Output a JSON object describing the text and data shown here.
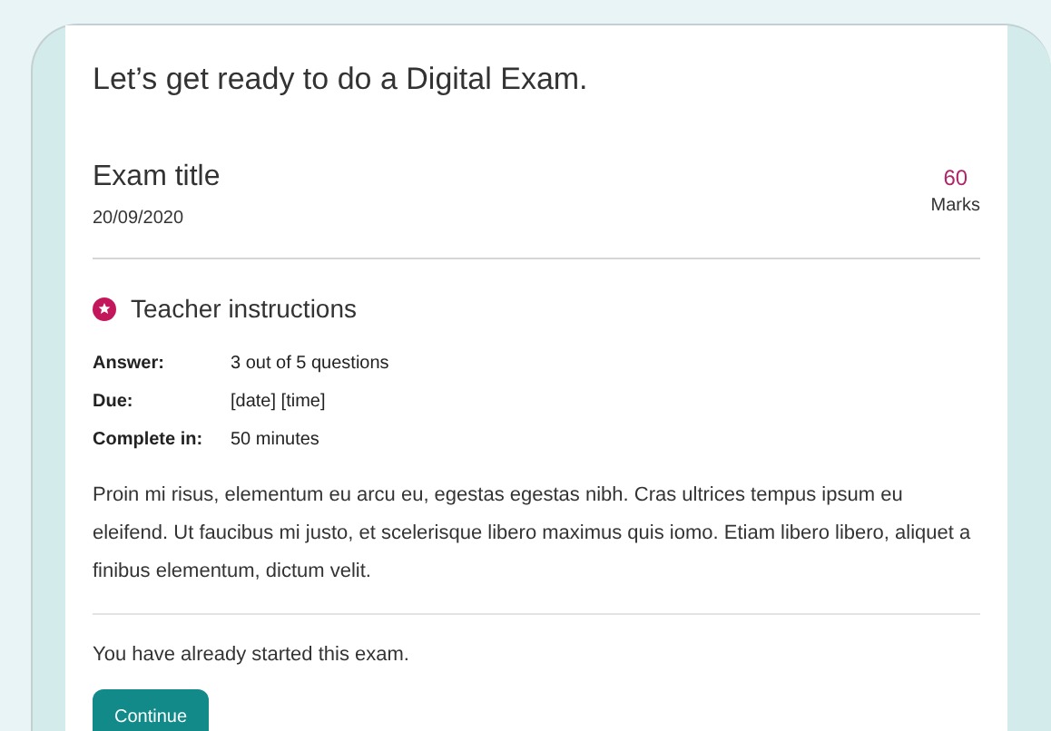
{
  "heading": "Let’s get ready to do a Digital Exam.",
  "exam": {
    "title": "Exam title",
    "date": "20/09/2020",
    "marks_value": "60",
    "marks_label": "Marks"
  },
  "instructions": {
    "title": "Teacher instructions",
    "rows": [
      {
        "label": "Answer:",
        "value": "3 out of 5 questions"
      },
      {
        "label": "Due:",
        "value": "[date] [time]"
      },
      {
        "label": "Complete in:",
        "value": "50 minutes"
      }
    ],
    "text": "Proin mi risus, elementum eu arcu eu, egestas egestas nibh. Cras ultrices tempus ipsum eu eleifend. Ut faucibus mi justo, et scelerisque libero maximus quis iomo. Etiam libero libero, aliquet a finibus elementum, dictum velit."
  },
  "status": "You have already started this exam.",
  "button": "Continue"
}
